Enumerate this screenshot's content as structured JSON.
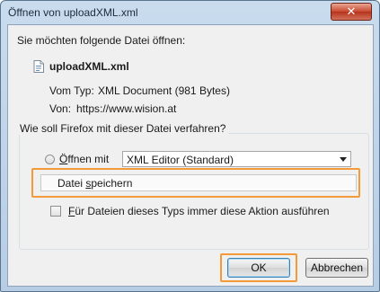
{
  "window": {
    "title": "Öffnen von uploadXML.xml",
    "close_glyph": "✕"
  },
  "dialog": {
    "prompt": "Sie möchten folgende Datei öffnen:",
    "file_name": "uploadXML.xml",
    "type_label": "Vom Typ:",
    "type_value": "XML Document (981 Bytes)",
    "from_label": "Von:",
    "from_value": "https://www.wision.at"
  },
  "action_group": {
    "legend": "Wie soll Firefox mit dieser Datei verfahren?",
    "open_with": {
      "label_prefix": "",
      "accesskey": "Ö",
      "label_rest": "ffnen mit",
      "checked": false
    },
    "app_select": {
      "value": "XML Editor (Standard)"
    },
    "save_file": {
      "label_prefix": "Datei ",
      "accesskey": "s",
      "label_rest": "peichern",
      "checked": true
    },
    "remember": {
      "accesskey": "F",
      "label_rest": "ür Dateien dieses Typs immer diese Aktion ausführen",
      "checked": false
    }
  },
  "buttons": {
    "ok": "OK",
    "cancel": "Abbrechen"
  },
  "colors": {
    "highlight": "#f39a3b",
    "titlebar": "#c9dcee",
    "close_button": "#c7492f"
  },
  "icons": [
    "close-icon",
    "xml-file-icon",
    "radio-icon",
    "checkbox-icon",
    "dropdown-arrow-icon"
  ]
}
